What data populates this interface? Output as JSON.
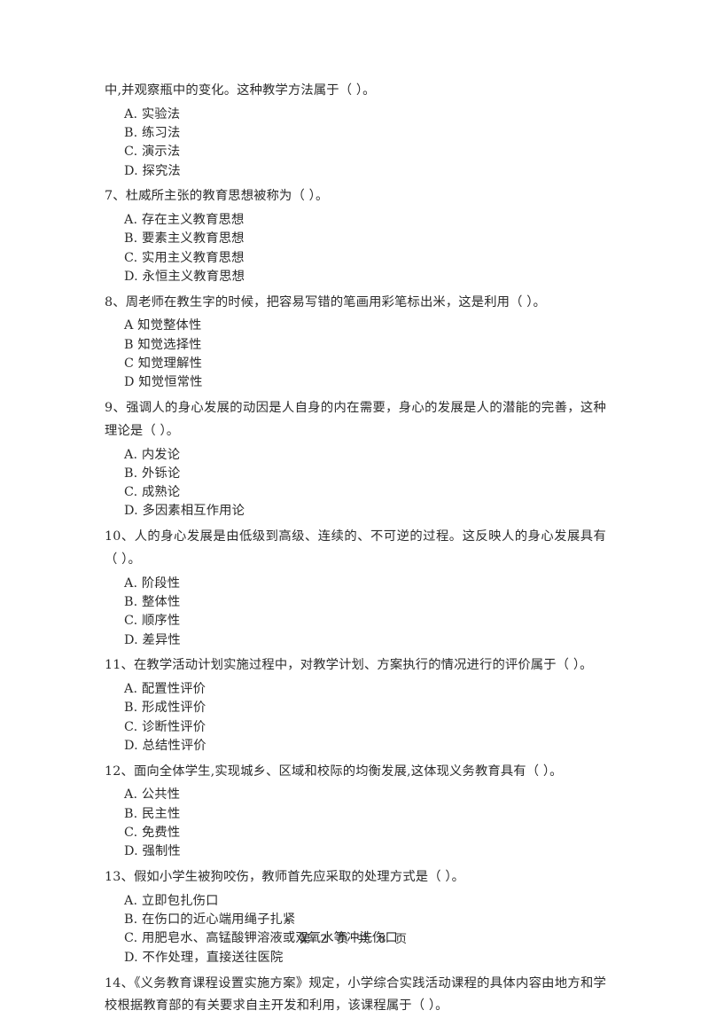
{
  "document": {
    "type": "exam-paper",
    "page_label": "第 2 页  共 8 页",
    "text_color": "#2b2b2b",
    "background_color": "#ffffff"
  },
  "continuation": {
    "stem": "中,并观察瓶中的变化。这种教学方法属于（    ）。",
    "options": [
      "A. 实验法",
      "B. 练习法",
      "C. 演示法",
      "D. 探究法"
    ]
  },
  "questions": [
    {
      "number": "7、",
      "stem": "7、杜威所主张的教育思想被称为（    ）。",
      "options": [
        "A. 存在主义教育思想",
        "B. 要素主义教育思想",
        "C. 实用主义教育思想",
        "D. 永恒主义教育思想"
      ]
    },
    {
      "number": "8、",
      "stem": "8、周老师在教生字的时候，把容易写错的笔画用彩笔标出米，这是利用（    ）。",
      "options": [
        "A  知觉整体性",
        "B  知觉选择性",
        "C  知觉理解性",
        "D  知觉恒常性"
      ]
    },
    {
      "number": "9、",
      "stem": "9、强调人的身心发展的动因是人自身的内在需要，身心的发展是人的潜能的完善，这种理论是（    ）。",
      "options": [
        "A. 内发论",
        "B. 外铄论",
        "C. 成熟论",
        "D. 多因素相互作用论"
      ]
    },
    {
      "number": "10、",
      "stem": "10、人的身心发展是由低级到高级、连续的、不可逆的过程。这反映人的身心发展具有（    ）。",
      "options": [
        "A. 阶段性",
        "B. 整体性",
        "C. 顺序性",
        "D. 差异性"
      ]
    },
    {
      "number": "11、",
      "stem": "11、在教学活动计划实施过程中，对教学计划、方案执行的情况进行的评价属于（    ）。",
      "options": [
        "A. 配置性评价",
        "B. 形成性评价",
        "C. 诊断性评价",
        "D. 总结性评价"
      ]
    },
    {
      "number": "12、",
      "stem": "12、面向全体学生,实现城乡、区域和校际的均衡发展,这体现义务教育具有（    ）。",
      "options": [
        "A. 公共性",
        "B. 民主性",
        "C. 免费性",
        "D. 强制性"
      ]
    },
    {
      "number": "13、",
      "stem": "13、假如小学生被狗咬伤，教师首先应采取的处理方式是（    ）。",
      "options": [
        "A. 立即包扎伤口",
        "B. 在伤口的近心端用绳子扎紧",
        "C. 用肥皂水、高锰酸钾溶液或双氧水等冲洗伤口",
        "D. 不作处理，直接送往医院"
      ]
    },
    {
      "number": "14、",
      "stem": "14、《义务教育课程设置实施方案》规定，小学综合实践活动课程的具体内容由地方和学校根据教育部的有关要求自主开发和利用，该课程属于（    ）。",
      "options": []
    }
  ]
}
